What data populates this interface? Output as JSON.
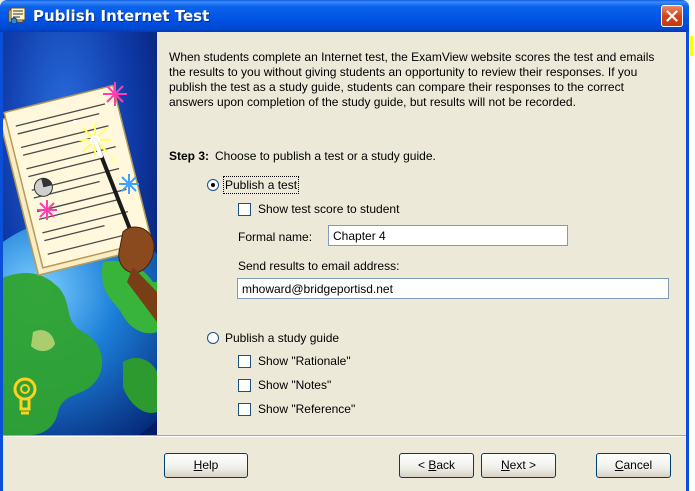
{
  "window": {
    "title": "Publish Internet Test",
    "colors": {
      "titlebar": "#0053e6",
      "face": "#ece9d8",
      "close": "#d8431b",
      "radio_selected": "#21a121"
    }
  },
  "intro_text": "When students complete an Internet test, the ExamView website scores the test and emails the results to you without giving students an opportunity to review their responses.  If you publish the test as a study guide, students can compare their responses to the correct answers upon completion of the study guide, but results will not be recorded.",
  "step": {
    "label": "Step 3:",
    "text": "Choose to publish a test or a study guide."
  },
  "publish_test": {
    "label": "Publish a test",
    "selected": true,
    "show_score_label": "Show test score to student",
    "show_score_checked": false,
    "formal_name_label": "Formal name:",
    "formal_name_value": "Chapter 4",
    "email_label": "Send results to email address:",
    "email_value": "mhoward@bridgeportisd.net"
  },
  "publish_study_guide": {
    "label": "Publish a study guide",
    "selected": false,
    "options": [
      {
        "label": "Show \"Rationale\"",
        "checked": false
      },
      {
        "label": "Show \"Notes\"",
        "checked": false
      },
      {
        "label": "Show \"Reference\"",
        "checked": false
      }
    ]
  },
  "buttons": {
    "help": {
      "mnemonic": "H",
      "rest": "elp"
    },
    "back": {
      "prefix": "< ",
      "mnemonic": "B",
      "rest": "ack"
    },
    "next": {
      "mnemonic": "N",
      "rest": "ext >"
    },
    "cancel": {
      "mnemonic": "C",
      "rest": "ancel"
    }
  },
  "icons": [
    "app-icon",
    "close-icon",
    "wizard-illustration",
    "lightbulb-icon"
  ]
}
